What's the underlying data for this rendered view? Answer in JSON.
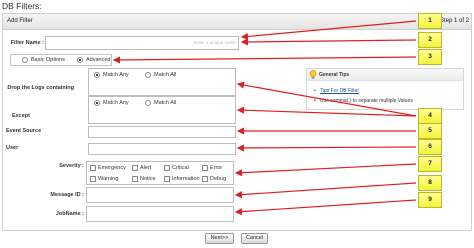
{
  "page_title": "DB Filters:",
  "header": {
    "title": "Add Filter",
    "step": "Step 1 of 2"
  },
  "filter_name": {
    "label": "Filter Name :",
    "placeholder": "Enter a unique name"
  },
  "mode": {
    "basic_label": "Basic Options",
    "advanced_label": "Advanced",
    "selected": "Advanced"
  },
  "drop_logs": {
    "label": "Drop the Logs containing",
    "match_any": "Match Any",
    "match_all": "Match All",
    "selected": "Match Any"
  },
  "except": {
    "label": "Except",
    "match_any": "Match Any",
    "match_all": "Match All",
    "selected": "Match Any"
  },
  "event_source": {
    "label": "Event Source"
  },
  "user": {
    "label": "User"
  },
  "severity": {
    "label": "Severity :",
    "options": [
      "Emergency",
      "Alert",
      "Critical",
      "Error",
      "Warning",
      "Notice",
      "Information",
      "Debug"
    ]
  },
  "message_id": {
    "label": "Message ID :"
  },
  "jobname": {
    "label": "JobName :"
  },
  "tips": {
    "title": "General Tips",
    "items": [
      "Tips For DB Filter",
      "Use comma(,) to separate multiple Values"
    ]
  },
  "buttons": {
    "next": "Next>>",
    "cancel": "Cancel"
  },
  "callouts": [
    "1",
    "2",
    "3",
    "4",
    "5",
    "6",
    "7",
    "8",
    "9"
  ],
  "colors": {
    "callout_fill": "#f3f33a",
    "arrow": "#e02020",
    "link": "#1b57a6"
  },
  "icons": {
    "tips": "lightbulb-icon"
  }
}
